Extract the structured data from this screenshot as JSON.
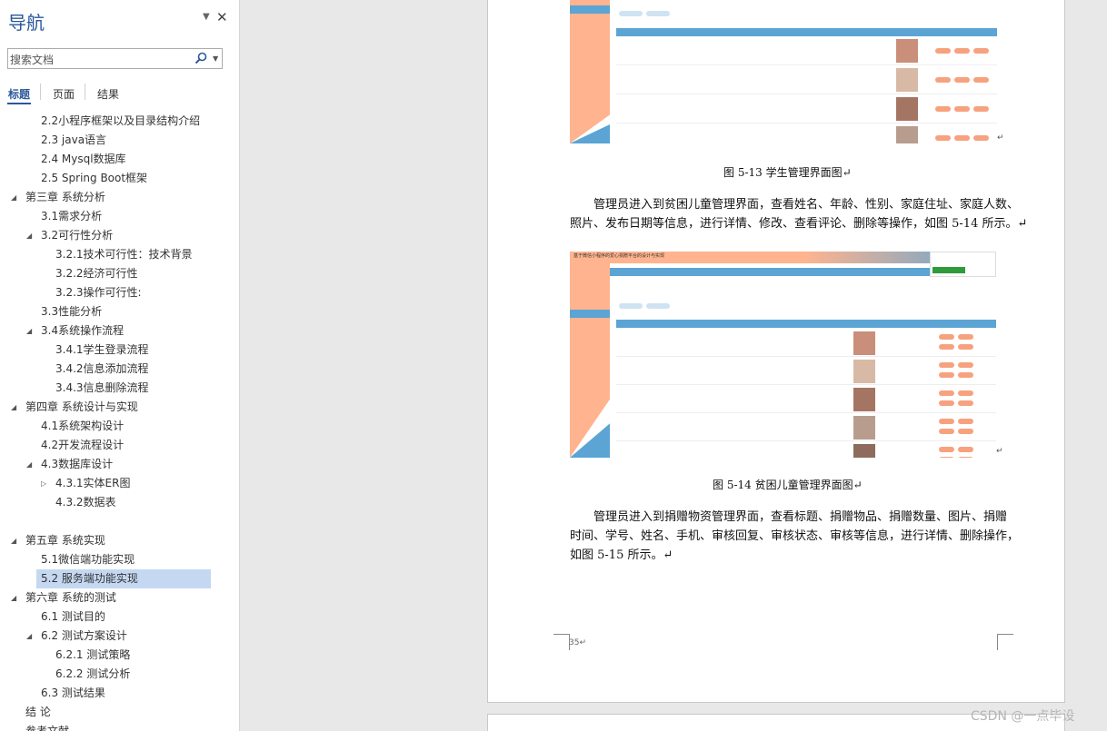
{
  "nav": {
    "title": "导航",
    "search_placeholder": "搜索文档",
    "tabs": [
      "标题",
      "页面",
      "结果"
    ],
    "items": [
      {
        "label": "2.2小程序框架以及目录结构介绍",
        "level": 2,
        "toggle": "none"
      },
      {
        "label": "2.3 java语言",
        "level": 2,
        "toggle": "none"
      },
      {
        "label": "2.4  Mysql数据库",
        "level": 2,
        "toggle": "none"
      },
      {
        "label": "2.5 Spring Boot框架",
        "level": 2,
        "toggle": "none"
      },
      {
        "label": "第三章 系统分析",
        "level": 1,
        "toggle": "expanded"
      },
      {
        "label": "3.1需求分析",
        "level": 2,
        "toggle": "none"
      },
      {
        "label": "3.2可行性分析",
        "level": 2,
        "toggle": "expanded"
      },
      {
        "label": "3.2.1技术可行性：技术背景",
        "level": 3,
        "toggle": "none"
      },
      {
        "label": "3.2.2经济可行性",
        "level": 3,
        "toggle": "none"
      },
      {
        "label": "3.2.3操作可行性:",
        "level": 3,
        "toggle": "none"
      },
      {
        "label": "3.3性能分析",
        "level": 2,
        "toggle": "none"
      },
      {
        "label": "3.4系统操作流程",
        "level": 2,
        "toggle": "expanded"
      },
      {
        "label": "3.4.1学生登录流程",
        "level": 3,
        "toggle": "none"
      },
      {
        "label": "3.4.2信息添加流程",
        "level": 3,
        "toggle": "none"
      },
      {
        "label": "3.4.3信息删除流程",
        "level": 3,
        "toggle": "none"
      },
      {
        "label": "第四章 系统设计与实现",
        "level": 1,
        "toggle": "expanded"
      },
      {
        "label": "4.1系统架构设计",
        "level": 2,
        "toggle": "none"
      },
      {
        "label": "4.2开发流程设计",
        "level": 2,
        "toggle": "none"
      },
      {
        "label": "4.3数据库设计",
        "level": 2,
        "toggle": "expanded"
      },
      {
        "label": "4.3.1实体ER图",
        "level": 3,
        "toggle": "collapsed"
      },
      {
        "label": "4.3.2数据表",
        "level": 3,
        "toggle": "none"
      },
      {
        "label": "",
        "level": 0,
        "toggle": "none"
      },
      {
        "label": "第五章 系统实现",
        "level": 1,
        "toggle": "expanded"
      },
      {
        "label": "5.1微信端功能实现",
        "level": 2,
        "toggle": "none"
      },
      {
        "label": "5.2 服务端功能实现",
        "level": 2,
        "toggle": "none",
        "active": true
      },
      {
        "label": "第六章   系统的测试",
        "level": 1,
        "toggle": "expanded"
      },
      {
        "label": "6.1 测试目的",
        "level": 2,
        "toggle": "none"
      },
      {
        "label": "6.2 测试方案设计",
        "level": 2,
        "toggle": "expanded"
      },
      {
        "label": "6.2.1 测试策略",
        "level": 3,
        "toggle": "none"
      },
      {
        "label": "6.2.2 测试分析",
        "level": 3,
        "toggle": "none"
      },
      {
        "label": "6.3 测试结果",
        "level": 2,
        "toggle": "none"
      },
      {
        "label": "结  论",
        "level": 1,
        "toggle": "none"
      },
      {
        "label": "参考文献",
        "level": 1,
        "toggle": "none"
      }
    ]
  },
  "document": {
    "caption1": "图 5-13 学生管理界面图↵",
    "para1_line1": "管理员进入到贫困儿童管理界面，查看姓名、年龄、性别、家庭住址、家庭人数、",
    "para1_line2": "照片、发布日期等信息，进行详情、修改、查看评论、删除等操作，如图 5-14 所示。↵",
    "caption2": "图 5-14 贫困儿童管理界面图↵",
    "para2_line1": "管理员进入到捐赠物资管理界面，查看标题、捐赠物品、捐赠数量、图片、捐赠",
    "para2_line2": "时间、学号、姓名、手机、审核回复、审核状态、审核等信息，进行详情、删除操作，",
    "para2_line3": "如图 5-15 所示。↵",
    "page_number": "35↵",
    "screenshot2_title": "基于微信小程序的爱心捐赠平台的设计与实现"
  },
  "watermark": "CSDN @一点毕设",
  "colors": {
    "accent": "#2b579a",
    "active_bg": "#c5d8f2",
    "orange": "#ffb48f",
    "blue": "#5ba4d4"
  }
}
